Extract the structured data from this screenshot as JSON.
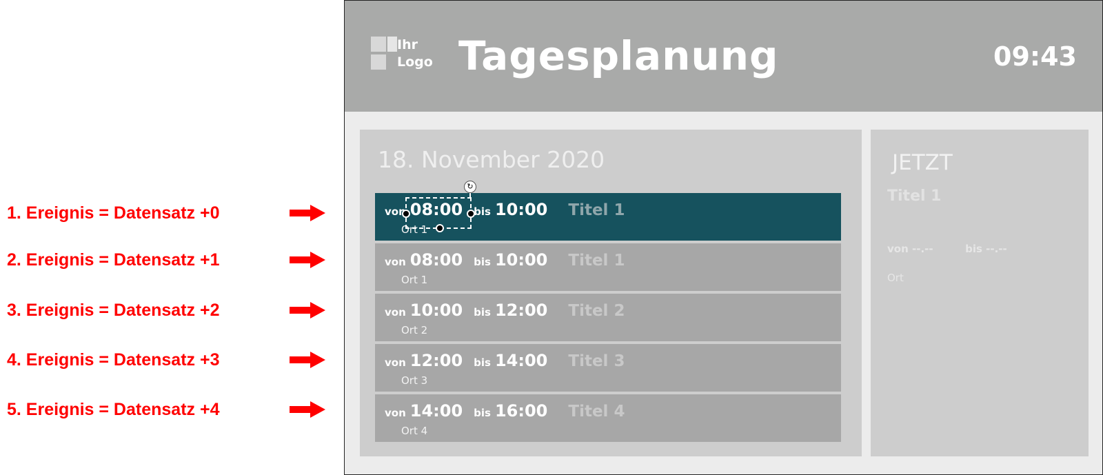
{
  "annotations": [
    "1. Ereignis = Datensatz +0",
    "2. Ereignis = Datensatz +1",
    "3. Ereignis = Datensatz +2",
    "4. Ereignis = Datensatz +3",
    "5. Ereignis = Datensatz +4"
  ],
  "header": {
    "logo_line1": "Ihr",
    "logo_line2": "Logo",
    "title": "Tagesplanung",
    "clock": "09:43"
  },
  "schedule": {
    "date": "18. November 2020",
    "von_label": "von",
    "bis_label": "bis",
    "events": [
      {
        "from": "08:00",
        "to": "10:00",
        "title": "Titel 1",
        "location": "Ort 1",
        "active": true
      },
      {
        "from": "08:00",
        "to": "10:00",
        "title": "Titel 1",
        "location": "Ort 1",
        "active": false
      },
      {
        "from": "10:00",
        "to": "12:00",
        "title": "Titel 2",
        "location": "Ort 2",
        "active": false
      },
      {
        "from": "12:00",
        "to": "14:00",
        "title": "Titel 3",
        "location": "Ort 3",
        "active": false
      },
      {
        "from": "14:00",
        "to": "16:00",
        "title": "Titel 4",
        "location": "Ort 4",
        "active": false
      }
    ]
  },
  "now_panel": {
    "label": "JETZT",
    "title": "Titel 1",
    "von_label": "von",
    "von_value": "--.--",
    "bis_label": "bis",
    "bis_value": "--.--",
    "location": "Ort"
  },
  "colors": {
    "annotation": "#ff0000",
    "active_event": "#16525e",
    "inactive_event": "#a7a7a7",
    "header": "#a9aaa9"
  }
}
